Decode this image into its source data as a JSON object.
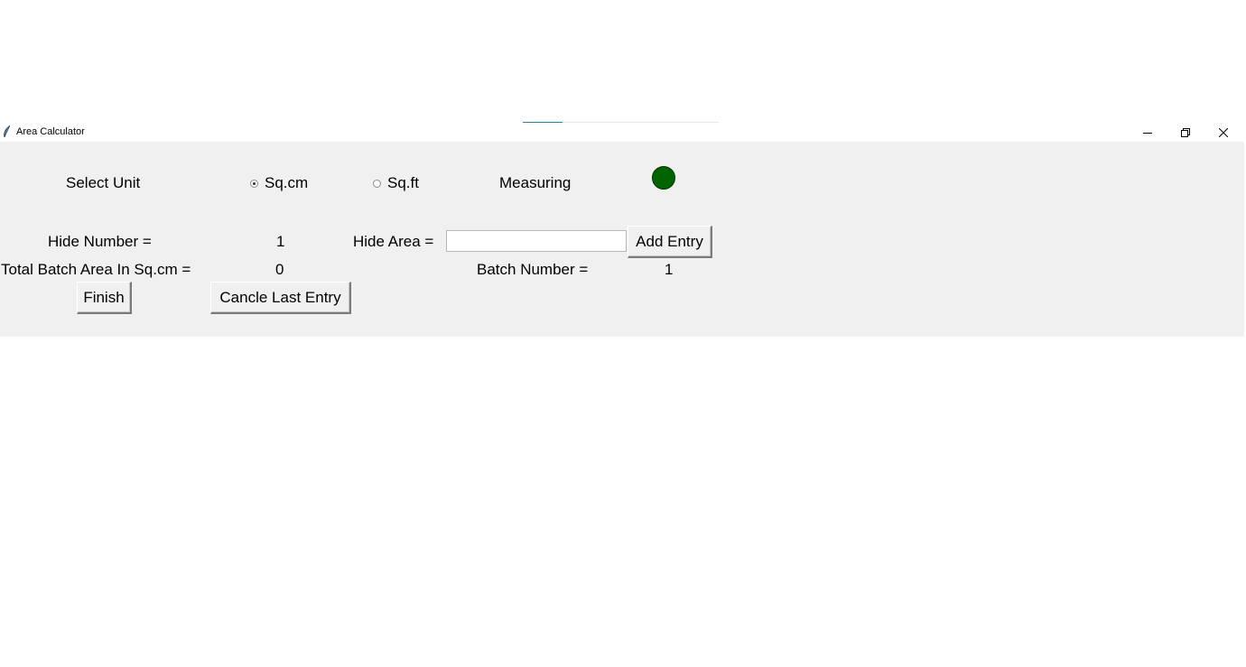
{
  "window": {
    "title": "Area Calculator",
    "controls": {
      "minimize_icon": "minimize-icon",
      "maximize_icon": "restore-icon",
      "close_icon": "close-icon"
    }
  },
  "unit": {
    "label": "Select Unit",
    "options": [
      {
        "label": "Sq.cm",
        "selected": true
      },
      {
        "label": "Sq.ft",
        "selected": false
      }
    ]
  },
  "status": {
    "label": "Measuring",
    "indicator_color": "#006400"
  },
  "hide": {
    "number_label": "Hide Number =",
    "number_value": "1",
    "area_label": "Hide Area =",
    "area_value": "",
    "add_button": "Add Entry"
  },
  "batch": {
    "total_label": "Total Batch Area In Sq.cm =",
    "total_value": "0",
    "number_label": "Batch Number =",
    "number_value": "1"
  },
  "actions": {
    "finish_button": "Finish",
    "cancel_button": "Cancle Last Entry"
  }
}
